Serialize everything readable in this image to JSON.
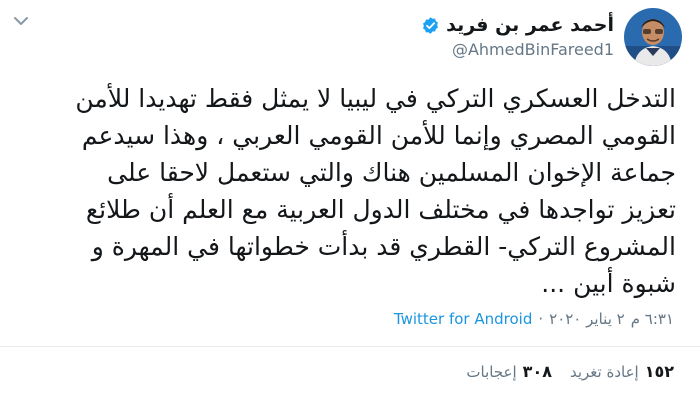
{
  "author": {
    "display_name": "أحمد عمر بن فريد",
    "handle": "@AhmedBinFareed1"
  },
  "tweet": {
    "lines": [
      "التدخل العسكري التركي في ليبيا لا يمثل فقط تهديدا للأمن",
      "القومي المصري وإنما للأمن القومي العربي ، وهذا سيدعم",
      "جماعة الإخوان المسلمين هناك والتي ستعمل لاحقا على",
      "تعزيز تواجدها في مختلف الدول العربية مع العلم أن طلائع",
      "المشروع التركي- القطري قد بدأت خطواتها في المهرة و",
      "شبوة أبين ..."
    ]
  },
  "meta": {
    "time": "٦:٣١ م",
    "separator": "·",
    "date": "٢ يناير ٢٠٢٠",
    "source": "Twitter for Android"
  },
  "stats": {
    "retweets_count": "١٥٢",
    "retweets_label": "إعادة تغريد",
    "likes_count": "٣٠٨",
    "likes_label": "إعجابات"
  },
  "colors": {
    "accent": "#1da1f2",
    "text": "#14171a",
    "muted": "#657786",
    "link": "#1b95e0"
  },
  "icons": {
    "verified": "verified-badge-icon",
    "menu": "chevron-down-icon"
  }
}
